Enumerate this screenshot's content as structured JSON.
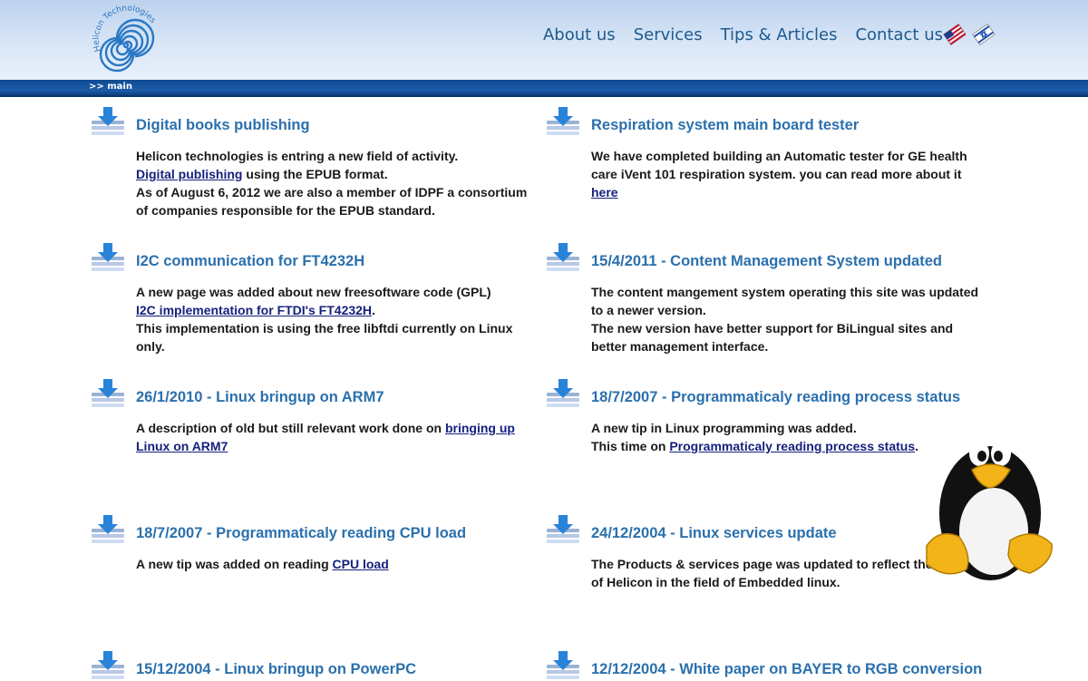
{
  "header": {
    "logo_text": "Helicon Technologies",
    "nav": [
      "About us",
      "Services",
      "Tips & Articles",
      "Contact us"
    ],
    "flags": [
      "english-flag-icon",
      "hebrew-flag-icon"
    ],
    "breadcrumb": ">> main"
  },
  "news": [
    {
      "title": "Digital books publishing",
      "line1": "Helicon technologies is entring a new field of activity.",
      "link": "Digital publishing",
      "after": " using the EPUB format.",
      "line3": "As of August 6, 2012 we are also a member of IDPF a consortium of companies responsible for the EPUB standard."
    },
    {
      "title": "Respiration system main board tester",
      "before": "We have completed building an Automatic tester for GE health care iVent 101 respiration system. you can read more about it ",
      "link": "here"
    },
    {
      "title": "I2C communication for FT4232H",
      "line1": "A new page was added about new freesoftware code (GPL)",
      "link": "I2C implementation for FTDI's FT4232H",
      "after": ".",
      "line3": "This implementation is using the free libftdi currently on Linux only."
    },
    {
      "title": "15/4/2011 - Content Management System updated",
      "line1": "The content mangement system operating this site was updated to a newer version.",
      "line2": "The new version have better support for BiLingual sites and better management interface."
    },
    {
      "title": "26/1/2010 - Linux bringup on ARM7",
      "before": "A description of old but still relevant work done on ",
      "link": "bringing up Linux on ARM7"
    },
    {
      "title": "18/7/2007 - Programmaticaly reading process status",
      "line1": "A new tip in Linux programming was added.",
      "before": "This time on ",
      "link": "Programmaticaly reading process status",
      "after": "."
    },
    {
      "title": "18/7/2007 - Programmaticaly reading CPU load",
      "before": "A new tip was added on reading ",
      "link": "CPU load"
    },
    {
      "title": "24/12/2004 - Linux services update",
      "line1": "The Products & services page was updated to reflect the activity of Helicon in the field of Embedded linux."
    },
    {
      "title": "15/12/2004 - Linux bringup on PowerPC"
    },
    {
      "title": "12/12/2004 - White paper on BAYER to RGB conversion"
    }
  ],
  "mascot": "tux-penguin-icon",
  "colors": {
    "heading": "#2b70ad",
    "link": "#14217d",
    "bar": "#1d5ca8",
    "nav": "#1d5a8c"
  }
}
